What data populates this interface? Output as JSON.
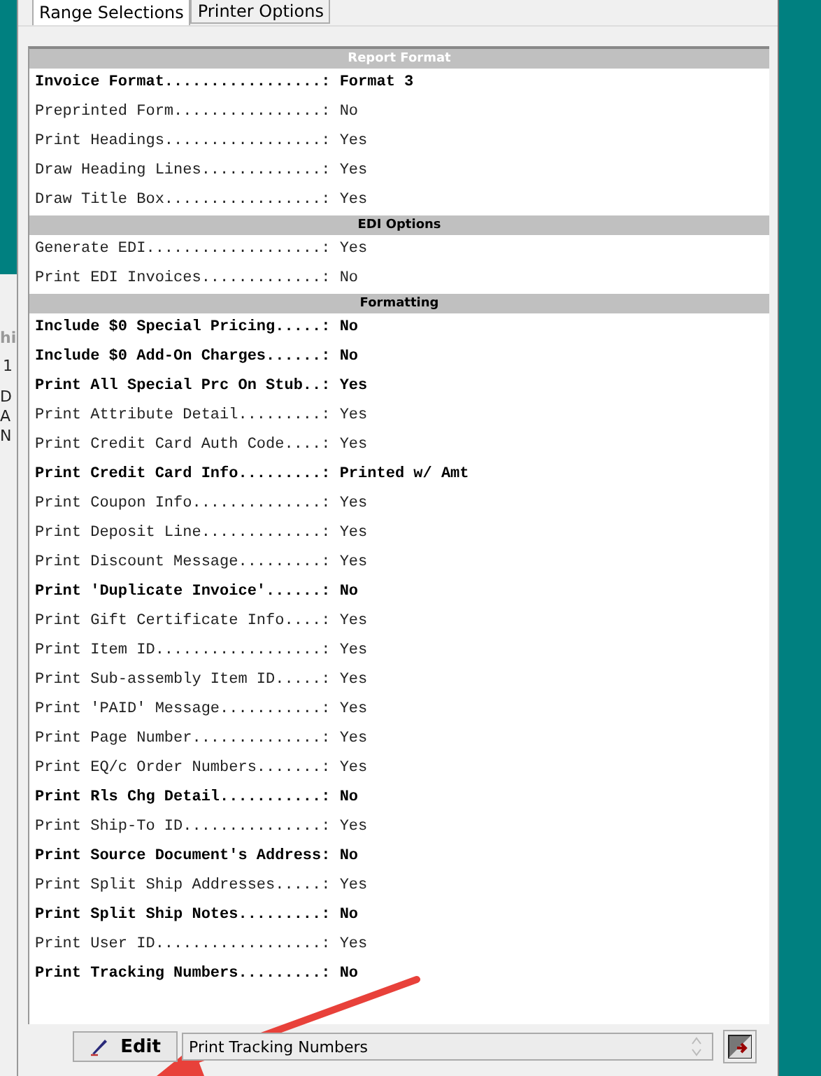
{
  "tabs": [
    {
      "label": "Range Selections",
      "selected": true
    },
    {
      "label": "Printer Options",
      "selected": false
    }
  ],
  "background_fragments": [
    "hi",
    "1",
    "D",
    "A",
    "N"
  ],
  "sections": [
    {
      "title": "Report Format",
      "rows": [
        {
          "label": "Invoice Format.................:",
          "value": "Format 3",
          "bold": true
        },
        {
          "label": "Preprinted Form................:",
          "value": "No",
          "bold": false
        },
        {
          "label": "Print Headings.................:",
          "value": "Yes",
          "bold": false
        },
        {
          "label": "Draw Heading Lines.............:",
          "value": "Yes",
          "bold": false
        },
        {
          "label": "Draw Title Box.................:",
          "value": "Yes",
          "bold": false
        }
      ]
    },
    {
      "title": "EDI Options",
      "rows": [
        {
          "label": "Generate EDI...................:",
          "value": "Yes",
          "bold": false
        },
        {
          "label": "Print EDI Invoices.............:",
          "value": "No",
          "bold": false
        }
      ]
    },
    {
      "title": "Formatting",
      "rows": [
        {
          "label": "Include $0 Special Pricing.....:",
          "value": "No",
          "bold": true
        },
        {
          "label": "Include $0 Add-On Charges......:",
          "value": "No",
          "bold": true
        },
        {
          "label": "Print All Special Prc On Stub..:",
          "value": "Yes",
          "bold": true
        },
        {
          "label": "Print Attribute Detail.........:",
          "value": "Yes",
          "bold": false
        },
        {
          "label": "Print Credit Card Auth Code....:",
          "value": "Yes",
          "bold": false
        },
        {
          "label": "Print Credit Card Info.........:",
          "value": "Printed w/ Amt",
          "bold": true
        },
        {
          "label": "Print Coupon Info..............:",
          "value": "Yes",
          "bold": false
        },
        {
          "label": "Print Deposit Line.............:",
          "value": "Yes",
          "bold": false
        },
        {
          "label": "Print Discount Message.........:",
          "value": "Yes",
          "bold": false
        },
        {
          "label": "Print 'Duplicate Invoice'......:",
          "value": "No",
          "bold": true
        },
        {
          "label": "Print Gift Certificate Info....:",
          "value": "Yes",
          "bold": false
        },
        {
          "label": "Print Item ID..................:",
          "value": "Yes",
          "bold": false
        },
        {
          "label": "Print Sub-assembly Item ID.....:",
          "value": "Yes",
          "bold": false
        },
        {
          "label": "Print 'PAID' Message...........:",
          "value": "Yes",
          "bold": false
        },
        {
          "label": "Print Page Number..............:",
          "value": "Yes",
          "bold": false
        },
        {
          "label": "Print EQ/c Order Numbers.......:",
          "value": "Yes",
          "bold": false
        },
        {
          "label": "Print Rls Chg Detail...........:",
          "value": "No",
          "bold": true
        },
        {
          "label": "Print Ship-To ID...............:",
          "value": "Yes",
          "bold": false
        },
        {
          "label": "Print Source Document's Address:",
          "value": "No",
          "bold": true
        },
        {
          "label": "Print Split Ship Addresses.....:",
          "value": "Yes",
          "bold": false
        },
        {
          "label": "Print Split Ship Notes.........:",
          "value": "No",
          "bold": true
        },
        {
          "label": "Print User ID..................:",
          "value": "Yes",
          "bold": false
        },
        {
          "label": "Print Tracking Numbers.........:",
          "value": "No",
          "bold": true
        }
      ]
    }
  ],
  "edit_button": "Edit",
  "description": "Print Tracking Numbers"
}
